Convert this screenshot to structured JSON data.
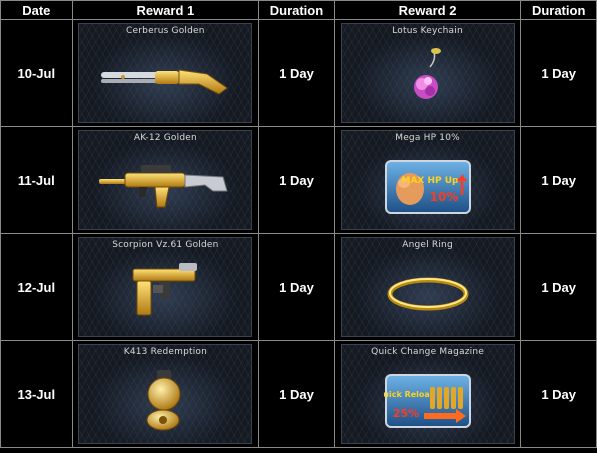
{
  "headers": {
    "date": "Date",
    "reward1": "Reward 1",
    "duration1": "Duration",
    "reward2": "Reward 2",
    "duration2": "Duration"
  },
  "rows": [
    {
      "date": "10-Jul",
      "reward1": {
        "name": "Cerberus Golden",
        "icon": "golden-shotgun-icon"
      },
      "duration1": "1 Day",
      "reward2": {
        "name": "Lotus Keychain",
        "icon": "lotus-keychain-icon"
      },
      "duration2": "1 Day"
    },
    {
      "date": "11-Jul",
      "reward1": {
        "name": "AK-12 Golden",
        "icon": "golden-rifle-icon"
      },
      "duration1": "1 Day",
      "reward2": {
        "name": "Mega HP 10%",
        "icon": "max-hp-up-icon",
        "badge_text": "MAX HP Up",
        "badge_value": "10%"
      },
      "duration2": "1 Day"
    },
    {
      "date": "12-Jul",
      "reward1": {
        "name": "Scorpion Vz.61 Golden",
        "icon": "golden-smg-icon"
      },
      "duration1": "1 Day",
      "reward2": {
        "name": "Angel Ring",
        "icon": "angel-ring-icon"
      },
      "duration2": "1 Day"
    },
    {
      "date": "13-Jul",
      "reward1": {
        "name": "K413 Redemption",
        "icon": "golden-grenade-icon"
      },
      "duration1": "1 Day",
      "reward2": {
        "name": "Quick Change Magazine",
        "icon": "quick-reload-icon",
        "badge_text": "Quick Reload",
        "badge_value": "25%"
      },
      "duration2": "1 Day"
    }
  ]
}
